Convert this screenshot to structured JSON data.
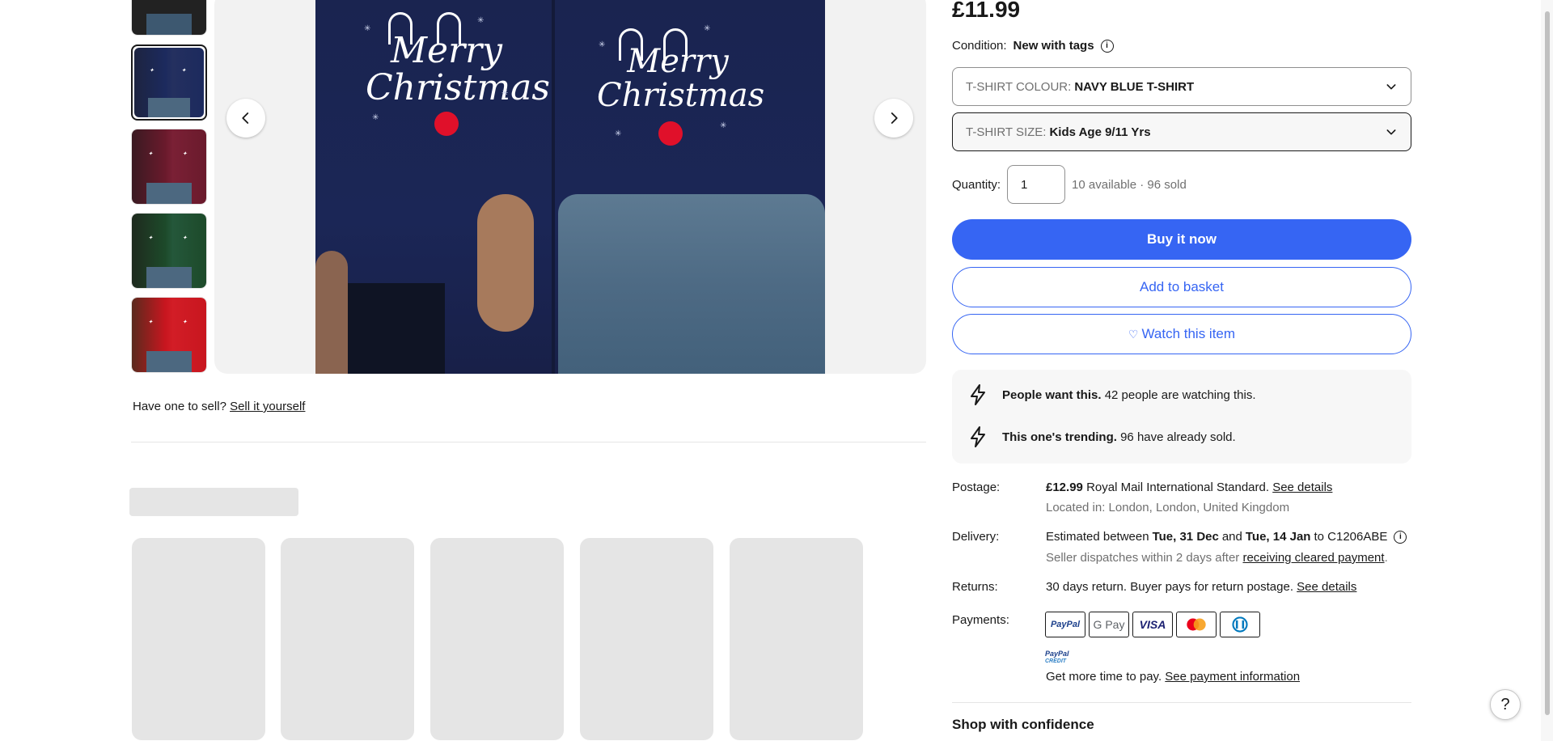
{
  "gallery": {
    "thumbnails": [
      {
        "name": "thumb-black",
        "colour": "#222222"
      },
      {
        "name": "thumb-navy",
        "colour": "#1c2a5e",
        "selected": true
      },
      {
        "name": "thumb-maroon",
        "colour": "#6a1a2c"
      },
      {
        "name": "thumb-green",
        "colour": "#1d4a2a"
      },
      {
        "name": "thumb-red",
        "colour": "#c8161f"
      }
    ],
    "hero_print_text": "Merry Christmas",
    "prev_icon": "chevron-left-icon",
    "next_icon": "chevron-right-icon"
  },
  "sell": {
    "prompt": "Have one to sell?",
    "link": "Sell it yourself"
  },
  "product": {
    "price": "£11.99",
    "condition_label": "Condition:",
    "condition_value": "New with tags",
    "colour_select": {
      "label": "T-SHIRT COLOUR:",
      "value": "NAVY BLUE T-SHIRT"
    },
    "size_select": {
      "label": "T-SHIRT SIZE:",
      "value": "Kids Age 9/11 Yrs"
    },
    "quantity_label": "Quantity:",
    "quantity_value": "1",
    "availability": "10 available · 96 sold",
    "buy_now": "Buy it now",
    "add_to_basket": "Add to basket",
    "watch": "Watch this item"
  },
  "signals": [
    {
      "bold": "People want this.",
      "text": "42 people are watching this."
    },
    {
      "bold": "This one's trending.",
      "text": "96 have already sold."
    }
  ],
  "postage": {
    "label": "Postage:",
    "price": "£12.99",
    "service": "Royal Mail International Standard.",
    "details_link": "See details",
    "located": "Located in: London, London, United Kingdom"
  },
  "delivery": {
    "label": "Delivery:",
    "prefix": "Estimated between",
    "date_from": "Tue, 31 Dec",
    "and": "and",
    "date_to": "Tue, 14 Jan",
    "to": "to C1206ABE",
    "dispatch_text": "Seller dispatches within 2 days after",
    "dispatch_link": "receiving cleared payment",
    "dispatch_end": "."
  },
  "returns": {
    "label": "Returns:",
    "text": "30 days return. Buyer pays for return postage.",
    "details_link": "See details"
  },
  "payments": {
    "label": "Payments:",
    "methods": [
      "PayPal",
      "G Pay",
      "VISA",
      "Mastercard",
      "Diners Club"
    ],
    "credit_top": "PayPal",
    "credit_bottom": "CREDIT",
    "credit_text": "Get more time to pay.",
    "credit_link": "See payment information"
  },
  "shop_confidence": "Shop with confidence",
  "help": "?",
  "colors": {
    "accent": "#3665f3",
    "text": "#191919",
    "muted": "#707070"
  }
}
